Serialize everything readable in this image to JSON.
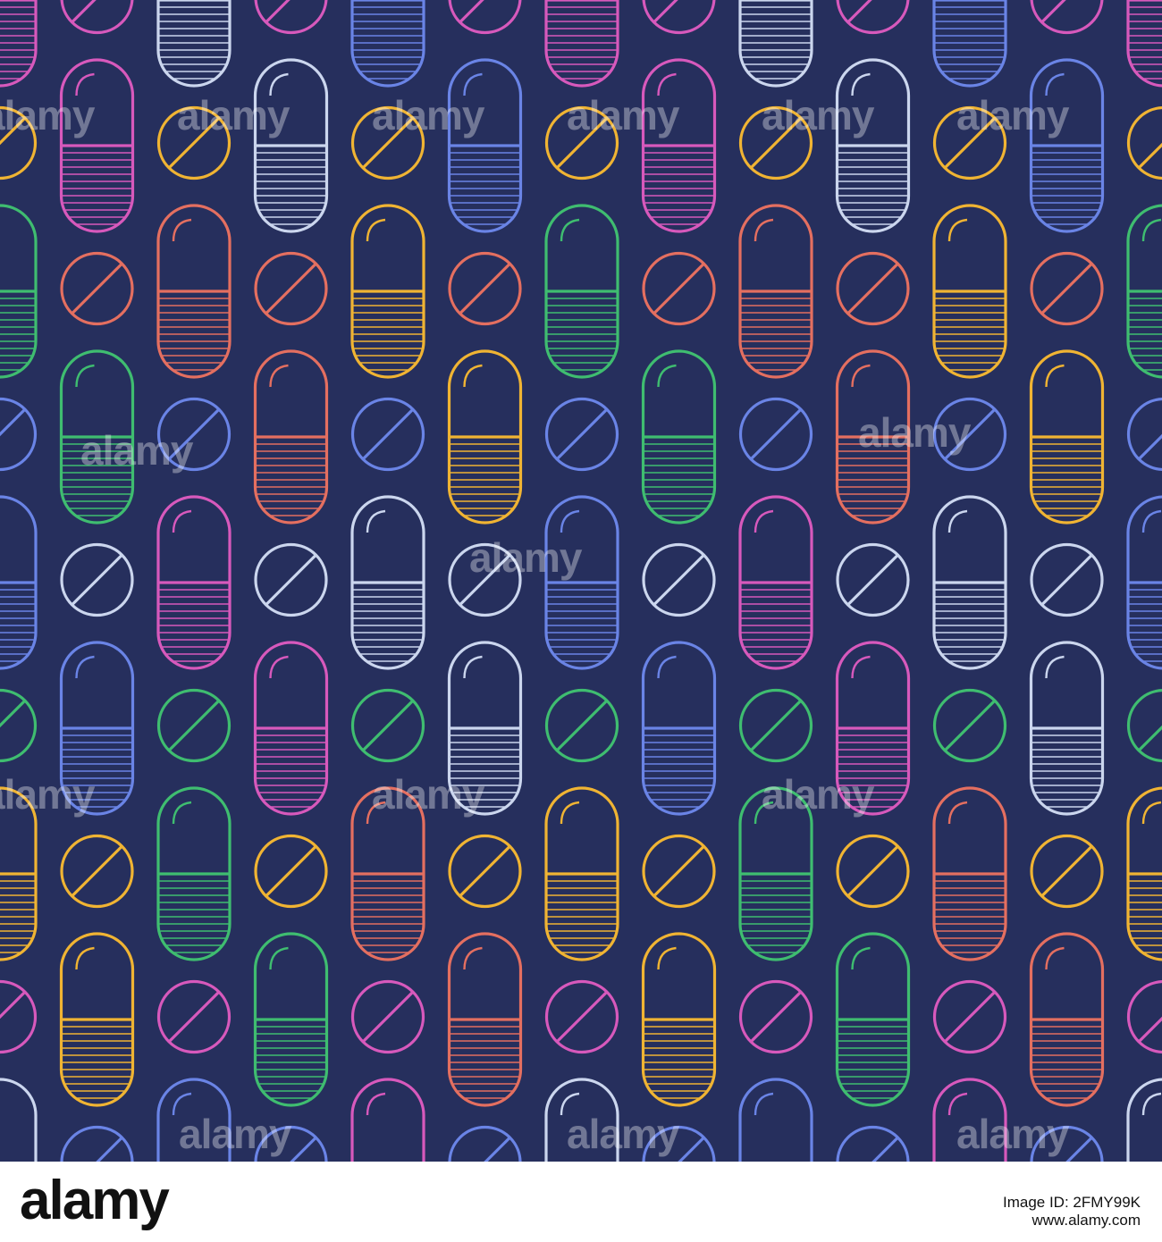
{
  "watermark": {
    "text": "alamy"
  },
  "footer": {
    "logo_text": "alamy",
    "image_id_label": "Image ID: 2FMY99K",
    "site": "www.alamy.com"
  },
  "colors": {
    "background": "#262f5d",
    "stroke": [
      "#3fbd70",
      "#6a84e6",
      "#f0b433",
      "#cbd6ee",
      "#e46f60",
      "#d759bc"
    ]
  },
  "motif": {
    "shapes": [
      "capsule-pill",
      "round-tablet"
    ]
  }
}
